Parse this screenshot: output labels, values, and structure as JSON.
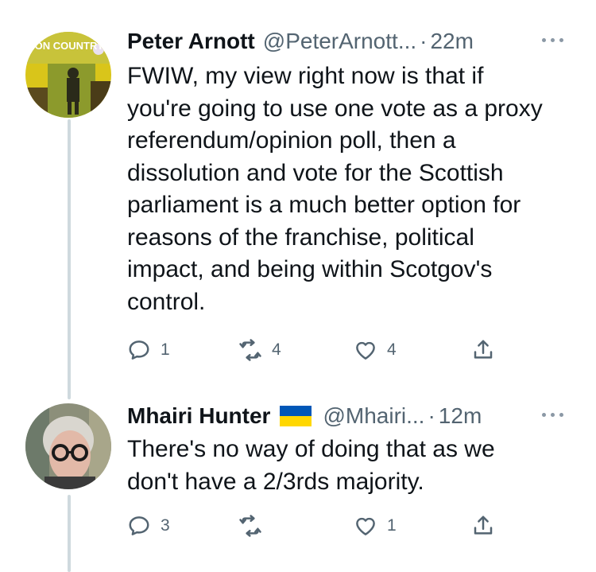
{
  "tweets": [
    {
      "avatar_label": "ION COUNTRY",
      "name": "Peter Arnott",
      "handle": "@PeterArnott...",
      "separator": "·",
      "time": "22m",
      "text": "FWIW, my view right now is that if\nyou're going to use one vote as a proxy\nreferendum/opinion poll, then a\ndissolution and vote for the Scottish\nparliament is a much better option for\nreasons of the franchise, political\nimpact, and being within Scotgov's\ncontrol.",
      "actions": {
        "reply_count": "1",
        "retweet_count": "4",
        "like_count": "4"
      }
    },
    {
      "name": "Mhairi Hunter",
      "flag": "ukraine-flag",
      "handle": "@Mhairi...",
      "separator": "·",
      "time": "12m",
      "text": "There's no way of doing that as we\ndon't have a 2/3rds majority.",
      "actions": {
        "reply_count": "3",
        "retweet_count": "",
        "like_count": "1"
      }
    }
  ],
  "colors": {
    "text": "#0f1419",
    "secondary": "#536471",
    "thread_line": "#cfd9de",
    "flag_blue": "#0057b7",
    "flag_yellow": "#ffd700"
  }
}
